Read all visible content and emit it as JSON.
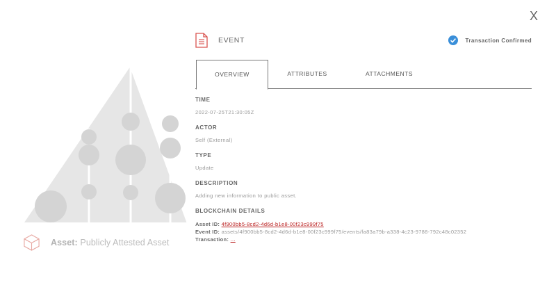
{
  "close_label": "X",
  "left": {
    "asset_prefix": "Asset:",
    "asset_name": "Publicly Attested Asset"
  },
  "event": {
    "title": "EVENT",
    "status": "Transaction Confirmed"
  },
  "tabs": [
    {
      "label": "OVERVIEW",
      "active": true
    },
    {
      "label": "ATTRIBUTES",
      "active": false
    },
    {
      "label": "ATTACHMENTS",
      "active": false
    }
  ],
  "fields": {
    "time": {
      "label": "TIME",
      "value": "2022-07-25T21:30:05Z"
    },
    "actor": {
      "label": "ACTOR",
      "value": "Self (External)"
    },
    "type": {
      "label": "TYPE",
      "value": "Update"
    },
    "description": {
      "label": "DESCRIPTION",
      "value": "Adding new information to public asset."
    }
  },
  "blockchain": {
    "label": "BLOCKCHAIN DETAILS",
    "asset_id_key": "Asset ID:",
    "asset_id": "4f900bb5-8cd2-4d6d-b1e8-00f23c999f75",
    "event_id_key": "Event ID:",
    "event_id": "assets/4f900bb5-8cd2-4d6d-b1e8-00f23c999f75/events/fa83a79b-a338-4c23-9788-792c48c02352",
    "transaction_key": "Transaction:",
    "transaction": "..."
  },
  "colors": {
    "accent_red": "#d9534f",
    "confirm_blue": "#3a8fd9",
    "illustration_grey": "#e4e4e4"
  }
}
